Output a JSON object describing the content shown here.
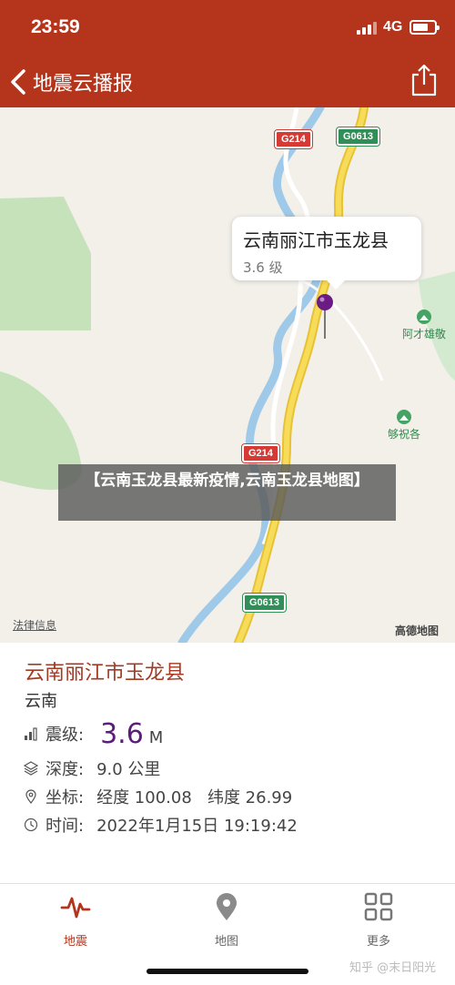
{
  "status_bar": {
    "time": "23:59",
    "network": "4G"
  },
  "nav": {
    "title": "地震云播报"
  },
  "map": {
    "roads": [
      "G214",
      "G0613",
      "G214",
      "G0613"
    ],
    "callout": {
      "title": "云南丽江市玉龙县",
      "subtitle": "3.6 级"
    },
    "pois": [
      "阿才雄敬",
      "够祝各"
    ],
    "legal_link": "法律信息",
    "logo": "高德地图"
  },
  "banner": {
    "text": "【云南玉龙县最新疫情,云南玉龙县地图】"
  },
  "detail": {
    "location_title": "云南丽江市玉龙县",
    "region": "云南",
    "magnitude_label": "震级:",
    "magnitude_value": "3.6",
    "magnitude_unit": "M",
    "depth_label": "深度:",
    "depth_value": "9.0 公里",
    "coord_label": "坐标:",
    "coord_value": "经度 100.08   纬度 26.99",
    "time_label": "时间:",
    "time_value": "2022年1月15日 19:19:42"
  },
  "tabs": [
    {
      "label": "地震",
      "icon": "pulse-icon",
      "active": true
    },
    {
      "label": "地图",
      "icon": "location-pin-icon",
      "active": false
    },
    {
      "label": "更多",
      "icon": "grid-icon",
      "active": false
    }
  ],
  "watermark": "知乎 @末日阳光",
  "colors": {
    "header": "#b5341c",
    "accent": "#a33a22",
    "magnitude": "#5a1d7a"
  }
}
